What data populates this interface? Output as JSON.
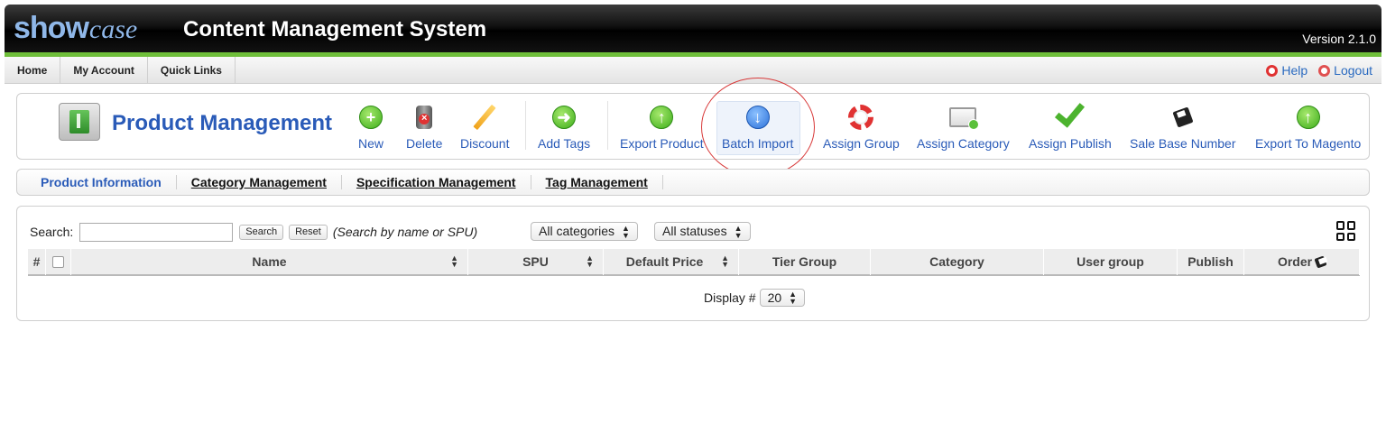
{
  "header": {
    "logo_show": "show",
    "logo_case": "case",
    "title": "Content Management System",
    "version": "Version 2.1.0"
  },
  "topnav": {
    "items": [
      "Home",
      "My Account",
      "Quick Links"
    ],
    "help": "Help",
    "logout": "Logout"
  },
  "toolbar": {
    "title": "Product Management",
    "buttons": {
      "new": "New",
      "delete": "Delete",
      "discount": "Discount",
      "add_tags": "Add Tags",
      "export_product": "Export Product",
      "batch_import": "Batch Import",
      "assign_group": "Assign Group",
      "assign_category": "Assign Category",
      "assign_publish": "Assign Publish",
      "sale_base_number": "Sale Base Number",
      "export_to_magento": "Export To Magento"
    }
  },
  "tabs": [
    "Product Information",
    "Category Management",
    "Specification Management",
    "Tag Management"
  ],
  "search": {
    "label": "Search:",
    "value": "",
    "search_button": "Search",
    "reset_button": "Reset",
    "hint": "(Search by name or SPU)",
    "category_select": "All categories",
    "status_select": "All statuses"
  },
  "table": {
    "columns": {
      "index": "#",
      "name": "Name",
      "spu": "SPU",
      "default_price": "Default Price",
      "tier_group": "Tier Group",
      "category": "Category",
      "user_group": "User group",
      "publish": "Publish",
      "order": "Order"
    }
  },
  "pagination": {
    "display_label": "Display #",
    "page_size": "20"
  },
  "colors": {
    "header_accent": "#6fbf3a",
    "link_blue": "#2a5bb8",
    "highlight_ring": "#d83a3a"
  }
}
